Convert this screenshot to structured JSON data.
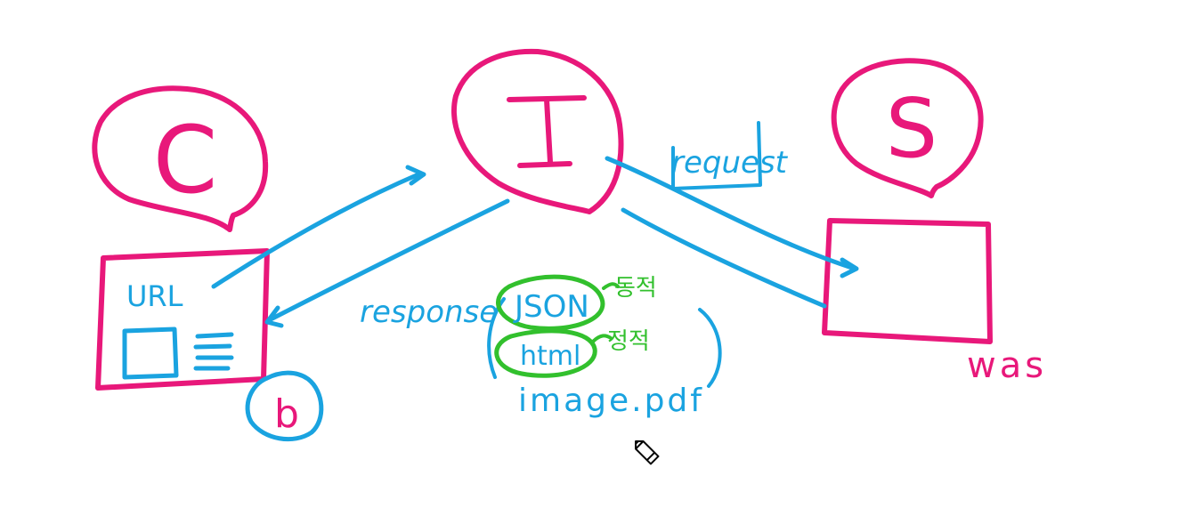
{
  "colors": {
    "pink": "#e8187a",
    "blue": "#1aa3e0",
    "green": "#32c02d",
    "background": "#ffffff"
  },
  "nodes": {
    "client_letter": "C",
    "intermediary_letter": "I",
    "server_letter": "S",
    "browser_url": "URL",
    "browser_badge": "b",
    "server_label": "was"
  },
  "edges": {
    "request_label": "request",
    "response_label": "response"
  },
  "response_types": {
    "json": "JSON",
    "json_note": "동적",
    "html": "html",
    "html_note": "정적",
    "other": "image.pdf"
  },
  "icons": [
    "pencil-cursor-icon",
    "hamburger-lines-icon"
  ]
}
